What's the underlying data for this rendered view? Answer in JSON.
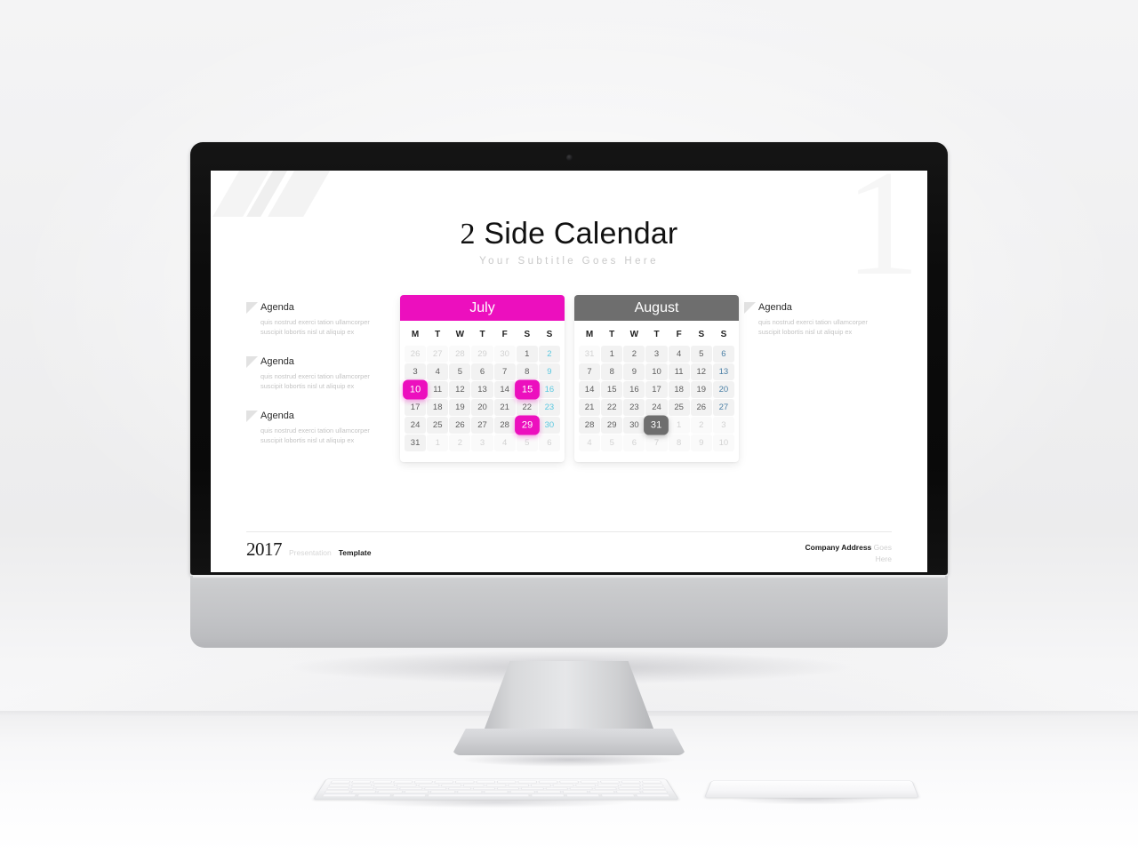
{
  "slide": {
    "title_numeral": "2",
    "title_words": " Side Calendar",
    "subtitle": "Your Subtitle Goes Here",
    "watermark": "1"
  },
  "agenda_left": [
    {
      "title": "Agenda",
      "body": "quis nostrud exerci tation ullamcorper suscipit lobortis nisl ut aliquip ex"
    },
    {
      "title": "Agenda",
      "body": "quis nostrud exerci tation ullamcorper suscipit lobortis nisl ut aliquip ex"
    },
    {
      "title": "Agenda",
      "body": "quis nostrud exerci tation ullamcorper suscipit lobortis nisl ut aliquip ex"
    }
  ],
  "agenda_right": [
    {
      "title": "Agenda",
      "body": "quis nostrud exerci tation ullamcorper suscipit lobortis nisl ut aliquip ex"
    }
  ],
  "calendars": [
    {
      "name": "July",
      "header_color": "#ec0fbe",
      "highlight_color": "#ec0fbe",
      "sunday_color": "#5bc8e0",
      "dow": [
        "M",
        "T",
        "W",
        "T",
        "F",
        "S",
        "S"
      ],
      "weeks": [
        [
          {
            "n": "26",
            "state": "muted"
          },
          {
            "n": "27",
            "state": "muted"
          },
          {
            "n": "28",
            "state": "muted"
          },
          {
            "n": "29",
            "state": "muted"
          },
          {
            "n": "30",
            "state": "muted"
          },
          {
            "n": "1",
            "state": "normal"
          },
          {
            "n": "2",
            "state": "sunday"
          }
        ],
        [
          {
            "n": "3",
            "state": "normal"
          },
          {
            "n": "4",
            "state": "normal"
          },
          {
            "n": "5",
            "state": "normal"
          },
          {
            "n": "6",
            "state": "normal"
          },
          {
            "n": "7",
            "state": "normal"
          },
          {
            "n": "8",
            "state": "normal"
          },
          {
            "n": "9",
            "state": "sunday"
          }
        ],
        [
          {
            "n": "10",
            "state": "highlight"
          },
          {
            "n": "11",
            "state": "normal"
          },
          {
            "n": "12",
            "state": "normal"
          },
          {
            "n": "13",
            "state": "normal"
          },
          {
            "n": "14",
            "state": "normal"
          },
          {
            "n": "15",
            "state": "highlight"
          },
          {
            "n": "16",
            "state": "sunday"
          }
        ],
        [
          {
            "n": "17",
            "state": "normal"
          },
          {
            "n": "18",
            "state": "normal"
          },
          {
            "n": "19",
            "state": "normal"
          },
          {
            "n": "20",
            "state": "normal"
          },
          {
            "n": "21",
            "state": "normal"
          },
          {
            "n": "22",
            "state": "normal"
          },
          {
            "n": "23",
            "state": "sunday"
          }
        ],
        [
          {
            "n": "24",
            "state": "normal"
          },
          {
            "n": "25",
            "state": "normal"
          },
          {
            "n": "26",
            "state": "normal"
          },
          {
            "n": "27",
            "state": "normal"
          },
          {
            "n": "28",
            "state": "normal"
          },
          {
            "n": "29",
            "state": "highlight"
          },
          {
            "n": "30",
            "state": "sunday"
          }
        ],
        [
          {
            "n": "31",
            "state": "normal"
          },
          {
            "n": "1",
            "state": "muted"
          },
          {
            "n": "2",
            "state": "muted"
          },
          {
            "n": "3",
            "state": "muted"
          },
          {
            "n": "4",
            "state": "muted"
          },
          {
            "n": "5",
            "state": "muted"
          },
          {
            "n": "6",
            "state": "muted"
          }
        ]
      ]
    },
    {
      "name": "August",
      "header_color": "#6e6e6e",
      "highlight_color": "#6e6e6e",
      "sunday_color": "#4a7fa5",
      "dow": [
        "M",
        "T",
        "W",
        "T",
        "F",
        "S",
        "S"
      ],
      "weeks": [
        [
          {
            "n": "31",
            "state": "muted"
          },
          {
            "n": "1",
            "state": "normal"
          },
          {
            "n": "2",
            "state": "normal"
          },
          {
            "n": "3",
            "state": "normal"
          },
          {
            "n": "4",
            "state": "normal"
          },
          {
            "n": "5",
            "state": "normal"
          },
          {
            "n": "6",
            "state": "sunday"
          }
        ],
        [
          {
            "n": "7",
            "state": "normal"
          },
          {
            "n": "8",
            "state": "normal"
          },
          {
            "n": "9",
            "state": "normal"
          },
          {
            "n": "10",
            "state": "normal"
          },
          {
            "n": "11",
            "state": "normal"
          },
          {
            "n": "12",
            "state": "normal"
          },
          {
            "n": "13",
            "state": "sunday"
          }
        ],
        [
          {
            "n": "14",
            "state": "normal"
          },
          {
            "n": "15",
            "state": "normal"
          },
          {
            "n": "16",
            "state": "normal"
          },
          {
            "n": "17",
            "state": "normal"
          },
          {
            "n": "18",
            "state": "normal"
          },
          {
            "n": "19",
            "state": "normal"
          },
          {
            "n": "20",
            "state": "sunday"
          }
        ],
        [
          {
            "n": "21",
            "state": "normal"
          },
          {
            "n": "22",
            "state": "normal"
          },
          {
            "n": "23",
            "state": "normal"
          },
          {
            "n": "24",
            "state": "normal"
          },
          {
            "n": "25",
            "state": "normal"
          },
          {
            "n": "26",
            "state": "normal"
          },
          {
            "n": "27",
            "state": "sunday"
          }
        ],
        [
          {
            "n": "28",
            "state": "normal"
          },
          {
            "n": "29",
            "state": "normal"
          },
          {
            "n": "30",
            "state": "normal"
          },
          {
            "n": "31",
            "state": "highlight"
          },
          {
            "n": "1",
            "state": "muted"
          },
          {
            "n": "2",
            "state": "muted"
          },
          {
            "n": "3",
            "state": "muted"
          }
        ],
        [
          {
            "n": "4",
            "state": "muted"
          },
          {
            "n": "5",
            "state": "muted"
          },
          {
            "n": "6",
            "state": "muted"
          },
          {
            "n": "7",
            "state": "muted"
          },
          {
            "n": "8",
            "state": "muted"
          },
          {
            "n": "9",
            "state": "muted"
          },
          {
            "n": "10",
            "state": "muted"
          }
        ]
      ]
    }
  ],
  "footer": {
    "year": "2017",
    "presentation": "Presentation",
    "template": "Template",
    "company": "Company Address",
    "goes_here": "Goes Here"
  }
}
